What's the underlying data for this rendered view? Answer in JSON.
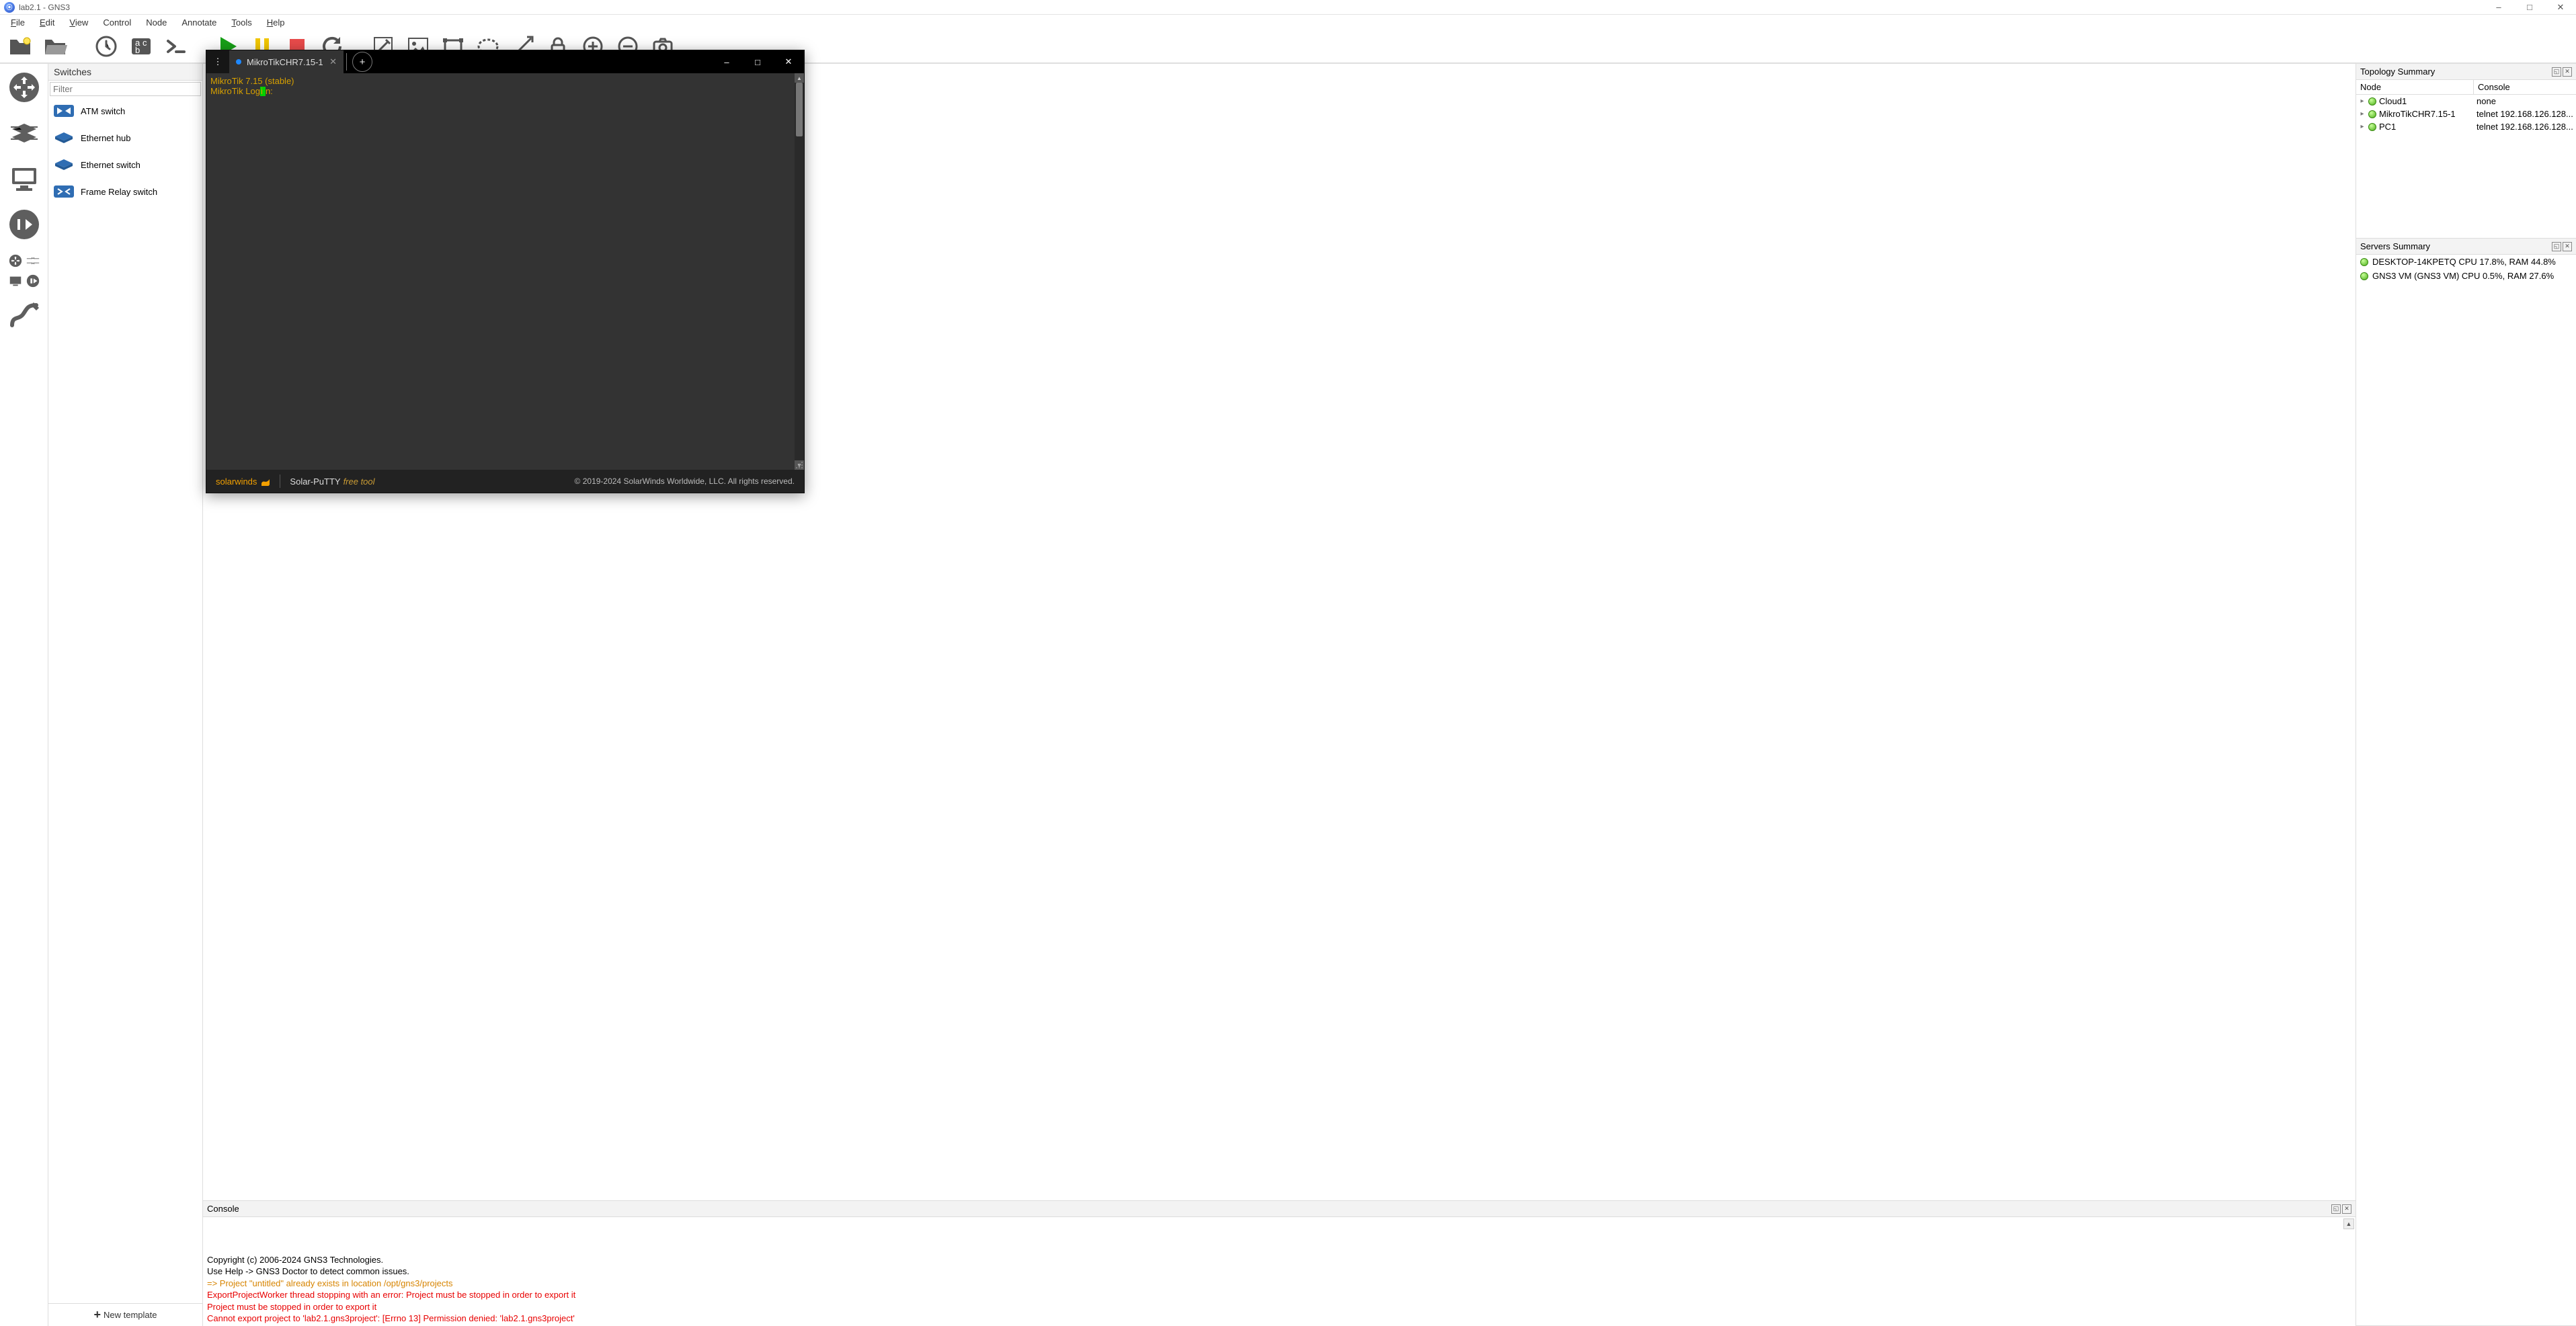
{
  "titlebar": {
    "title": "lab2.1 - GNS3"
  },
  "menu": [
    "File",
    "Edit",
    "View",
    "Control",
    "Node",
    "Annotate",
    "Tools",
    "Help"
  ],
  "devices": {
    "header": "Switches",
    "filter_placeholder": "Filter",
    "items": [
      {
        "label": "ATM switch",
        "icon": "switch-x"
      },
      {
        "label": "Ethernet hub",
        "icon": "hub"
      },
      {
        "label": "Ethernet switch",
        "icon": "hub"
      },
      {
        "label": "Frame Relay switch",
        "icon": "switch-fr"
      }
    ],
    "new_template": "New template"
  },
  "topology": {
    "header": "Topology Summary",
    "cols": {
      "node": "Node",
      "console": "Console"
    },
    "rows": [
      {
        "node": "Cloud1",
        "console": "none"
      },
      {
        "node": "MikroTikCHR7.15-1",
        "console": "telnet 192.168.126.128..."
      },
      {
        "node": "PC1",
        "console": "telnet 192.168.126.128..."
      }
    ]
  },
  "servers": {
    "header": "Servers Summary",
    "rows": [
      "DESKTOP-14KPETQ CPU 17.8%, RAM 44.8%",
      "GNS3 VM (GNS3 VM) CPU 0.5%, RAM 27.6%"
    ]
  },
  "console": {
    "header": "Console",
    "lines": [
      {
        "cls": "",
        "text": "Copyright (c) 2006-2024 GNS3 Technologies."
      },
      {
        "cls": "",
        "text": "Use Help -> GNS3 Doctor to detect common issues."
      },
      {
        "cls": "",
        "text": ""
      },
      {
        "cls": "warn",
        "text": "=> Project \"untitled\" already exists in location /opt/gns3/projects"
      },
      {
        "cls": "err",
        "text": "ExportProjectWorker thread stopping with an error: Project must be stopped in order to export it"
      },
      {
        "cls": "err",
        "text": "Project must be stopped in order to export it"
      },
      {
        "cls": "err",
        "text": "Cannot export project to 'lab2.1.gns3project': [Errno 13] Permission denied: 'lab2.1.gns3project'"
      }
    ]
  },
  "terminal": {
    "tab": "MikroTikCHR7.15-1",
    "lines": [
      "MikroTik 7.15 (stable)",
      "MikroTik Log"
    ],
    "after_cursor": "n:",
    "brand": "solarwinds",
    "product": "Solar-PuTTY",
    "free": "free tool",
    "copyright": "© 2019-2024 SolarWinds Worldwide, LLC. All rights reserved."
  }
}
